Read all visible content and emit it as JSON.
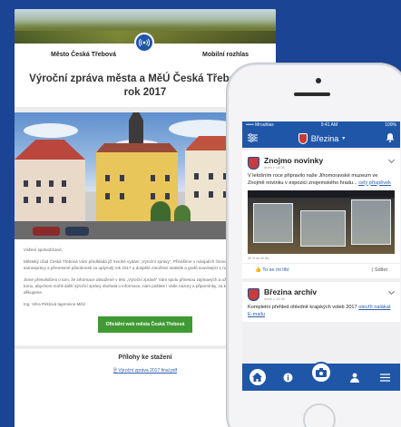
{
  "email": {
    "brand_left": "Město Česká Třebová",
    "brand_right": "Mobilní rozhlas",
    "title": "Výroční zpráva města a MěÚ Česká Třebová za rok 2017",
    "greeting": "Vážení spoluobčané,",
    "para1": "Městský úřad Česká Třebová Vám předkládá již mnohé vydání „Výroční zprávy“. Přinášíme v rukojatích činnostech na úseku samosprávy a přenesené působnosti za uplynulý rok 2017 a dospělé množství statistik a grafů související s nimi.",
    "para2": "Jsme přesvědčeni o tom, že informace obsažené v této „Výroční zprávě“ Vám spolu přinesou zajímavých a užitečných poznatků. K tomu, abychom mohli další výroční zprávy obohatit o informace, nám pošlete i Vaše názory a připomínky, za které Vám předem děkujeme.",
    "signature": "Ing. Věra Pirklová tajemnice MěÚ",
    "button": "Oficiální web města Česká Třebová",
    "attachments_heading": "Přílohy ke stažení",
    "attachment": "Výroční zpráva 2017 final.pdf"
  },
  "phone": {
    "status_carrier": "••••• Mrouhlas",
    "status_time": "9:41 AM",
    "status_battery": "100%",
    "city": "Březina",
    "card1": {
      "title": "Znojmo novinky",
      "time": "dnes v 14:30",
      "text": "V letošním roce připravilo naše Jihomoravské muzeum ve Znojmě novinku v expozici znojemského hradu...",
      "more": "celý příspěvek",
      "caption": "30 % se mi líbí",
      "like": "To se mi líbí",
      "share": "Sdílet"
    },
    "card2": {
      "title": "Březina archív",
      "time": "dnes v 14:30",
      "text": "Kompletní přehled ohledně krajských voleb 2017",
      "more": "otevřít nalákat E-mailu"
    },
    "icons": [
      "filter-icon",
      "chevron-down-icon",
      "bell-icon",
      "home-icon",
      "info-icon",
      "camera-icon",
      "user-icon",
      "menu-icon"
    ]
  },
  "colors": {
    "background": "#1c4494",
    "accent": "#1f56a8",
    "green": "#3f9a33"
  }
}
